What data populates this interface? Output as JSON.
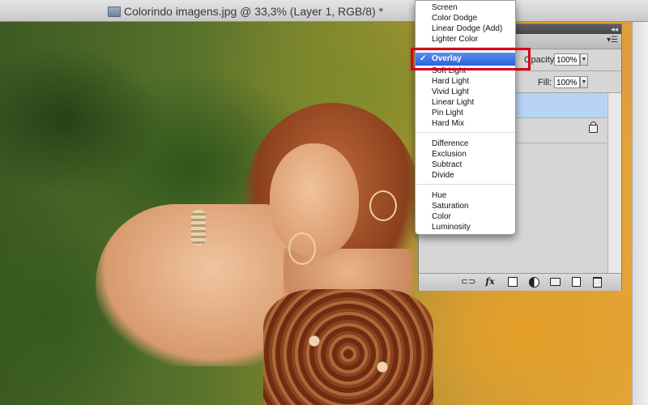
{
  "window": {
    "title": "Colorindo imagens.jpg @ 33,3% (Layer 1, RGB/8) *"
  },
  "layers_panel": {
    "opacity_label": "Opacity:",
    "opacity_value": "100%",
    "fill_label": "Fill:",
    "fill_value": "100%",
    "footer_icons": [
      "link-icon",
      "fx-icon",
      "mask-icon",
      "adjustment-icon",
      "folder-icon",
      "new-layer-icon",
      "trash-icon"
    ],
    "fx_label": "fx"
  },
  "blend_menu": {
    "selected": "Overlay",
    "check": "✓",
    "group_lighten": [
      "Screen",
      "Color Dodge",
      "Linear Dodge (Add)",
      "Lighter Color"
    ],
    "group_contrast": [
      "Overlay",
      "Soft Light",
      "Hard Light",
      "Vivid Light",
      "Linear Light",
      "Pin Light",
      "Hard Mix"
    ],
    "group_inversion": [
      "Difference",
      "Exclusion",
      "Subtract",
      "Divide"
    ],
    "group_component": [
      "Hue",
      "Saturation",
      "Color",
      "Luminosity"
    ]
  },
  "colors": {
    "highlight_border": "#d4001a",
    "menu_selected": "#2c63d9",
    "selected_layer": "#b8d4f4"
  }
}
